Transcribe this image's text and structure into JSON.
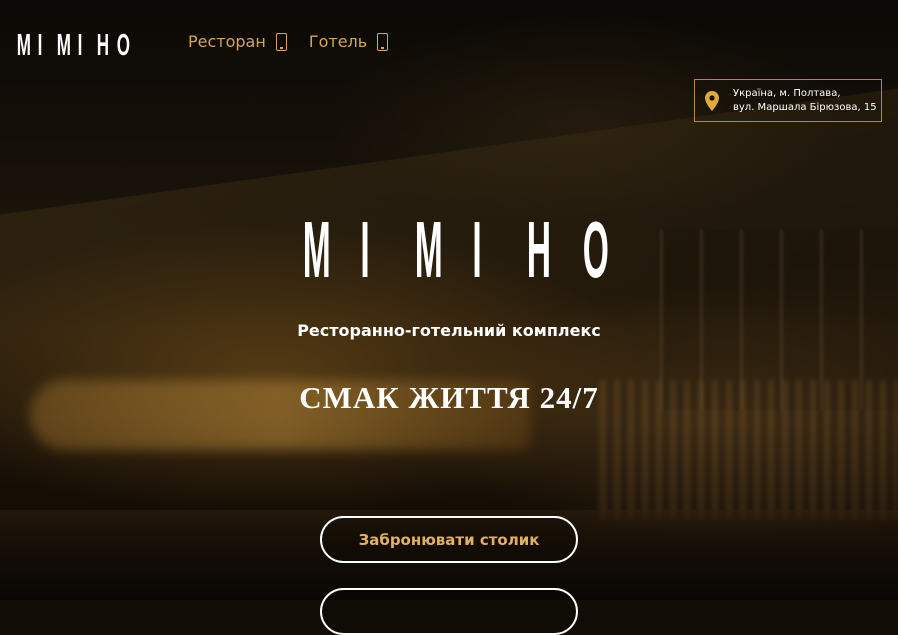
{
  "header": {
    "logo_letters": [
      "M",
      "I",
      "M",
      "I",
      "H",
      "O"
    ],
    "nav": [
      {
        "label": "Ресторан",
        "icon": "phone-icon"
      },
      {
        "label": "Готель",
        "icon": "phone-icon"
      }
    ],
    "address": {
      "icon": "map-pin-icon",
      "line1": "Україна, м. Полтава,",
      "line2": "вул. Маршала Бірюзова, 15"
    }
  },
  "hero": {
    "logo_letters": [
      "M",
      "I",
      "M",
      "I",
      "H",
      "O"
    ],
    "subtitle": "Ресторанно-готельний комплекс",
    "slogan": "СМАК ЖИТТЯ 24/7",
    "book_button": "Забронювати столик",
    "second_button": ""
  },
  "colors": {
    "accent": "#d5a55a",
    "button_text": "#e2b063",
    "text": "#ffffff"
  }
}
